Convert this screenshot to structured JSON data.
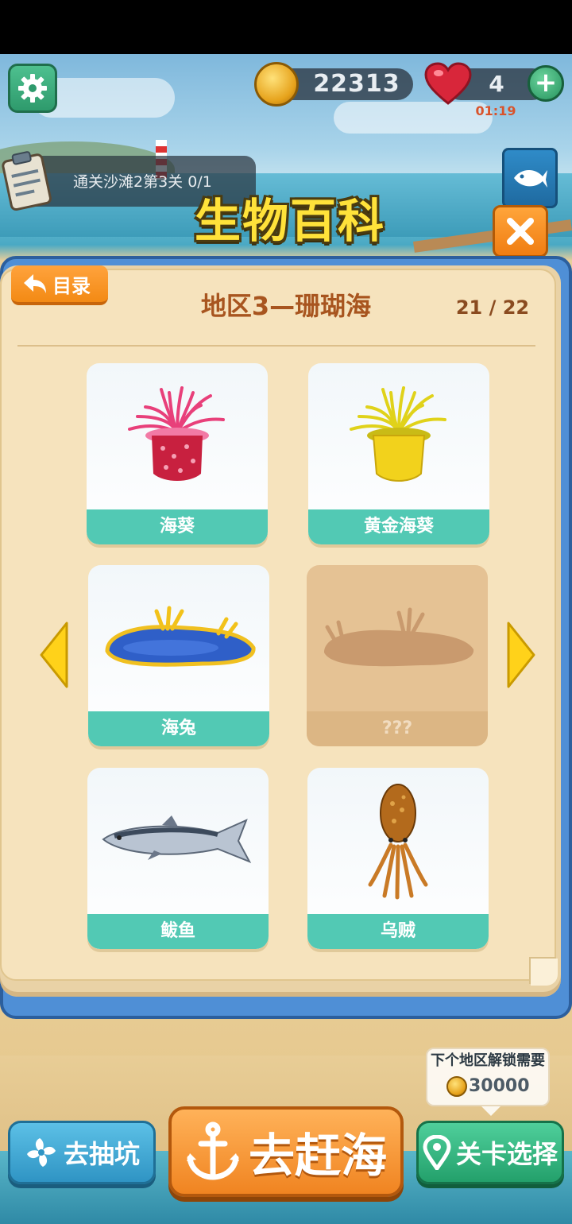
{
  "hud": {
    "coins": "22313",
    "lives": "4",
    "timer": "01:19",
    "plus_label": "+"
  },
  "task": {
    "text": "通关沙滩2第3关 0/1"
  },
  "title": "生物百科",
  "book": {
    "back_label": "目录",
    "region_title": "地区3—珊瑚海",
    "page_count": "21 / 22"
  },
  "creatures": [
    {
      "name": "海葵",
      "icon": "sea-anemone-icon",
      "locked": false
    },
    {
      "name": "黄金海葵",
      "icon": "golden-anemone-icon",
      "locked": false
    },
    {
      "name": "海兔",
      "icon": "sea-slug-icon",
      "locked": false
    },
    {
      "name": "???",
      "icon": "locked-silhouette-icon",
      "locked": true
    },
    {
      "name": "鲅鱼",
      "icon": "mackerel-icon",
      "locked": false
    },
    {
      "name": "乌贼",
      "icon": "cuttlefish-icon",
      "locked": false
    }
  ],
  "unlock": {
    "label": "下个地区解锁需要",
    "cost": "30000"
  },
  "buttons": {
    "gacha": "去抽坑",
    "go_sea": "去赶海",
    "level_select": "关卡选择"
  },
  "colors": {
    "card_label": "#52c9b4",
    "title_yellow": "#ffe23a",
    "accent_orange": "#f38a14",
    "panel_blue": "#4f8fd6"
  }
}
